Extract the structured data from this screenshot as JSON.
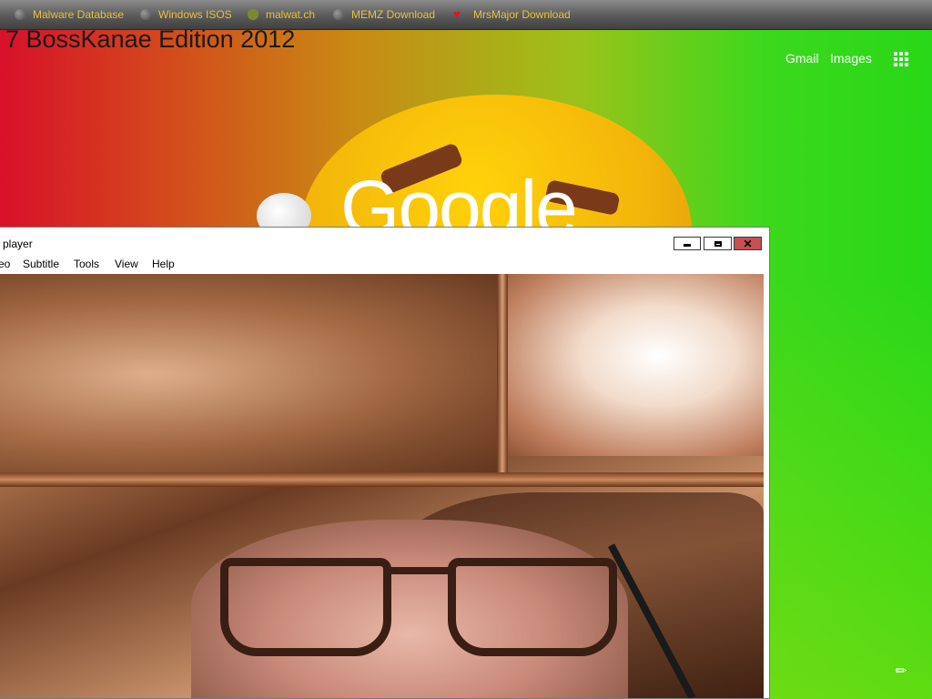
{
  "bookmarks": [
    {
      "label": "Malware Database",
      "icon": "globe-icon"
    },
    {
      "label": "Windows ISOS",
      "icon": "globe-icon"
    },
    {
      "label": "malwat.ch",
      "icon": "bug-icon"
    },
    {
      "label": "MEMZ Download",
      "icon": "globe-icon"
    },
    {
      "label": "MrsMajor Download",
      "icon": "heart-icon"
    }
  ],
  "page": {
    "title": "7 BossKanae Edition 2012",
    "links": [
      "Gmail",
      "Images"
    ],
    "logo_text": "Google"
  },
  "player": {
    "title": "player",
    "menu": [
      "eo",
      "Subtitle",
      "Tools",
      "View",
      "Help"
    ],
    "buttons": {
      "minimize": "minimize",
      "maximize": "maximize",
      "close": "✕"
    }
  },
  "colors": {
    "bookmark_text": "#e8c040",
    "close_button": "#c75050"
  }
}
